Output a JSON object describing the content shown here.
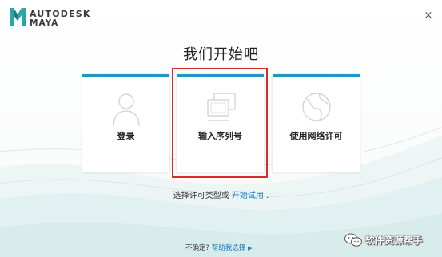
{
  "header": {
    "brand_top": "AUTODESK",
    "brand_bottom": "MAYA",
    "close_glyph": "×"
  },
  "main": {
    "title": "我们开始吧",
    "cards": [
      {
        "label": "登录",
        "icon": "user-icon"
      },
      {
        "label": "输入序列号",
        "icon": "serial-number-icon",
        "highlighted": true
      },
      {
        "label": "使用网络许可",
        "icon": "globe-icon"
      }
    ],
    "hint_prefix": "选择许可类型或",
    "hint_link": "开始试用",
    "hint_suffix": "."
  },
  "footer": {
    "question": "不确定?",
    "help_link": "帮助我选择"
  },
  "watermark": {
    "text": "软件资源帮手",
    "icon": "wechat-icon"
  },
  "colors": {
    "accent": "#1d9ac2",
    "highlight_border": "#d92b2b",
    "link": "#1a7fc1",
    "logo": "#2aa6a6"
  }
}
